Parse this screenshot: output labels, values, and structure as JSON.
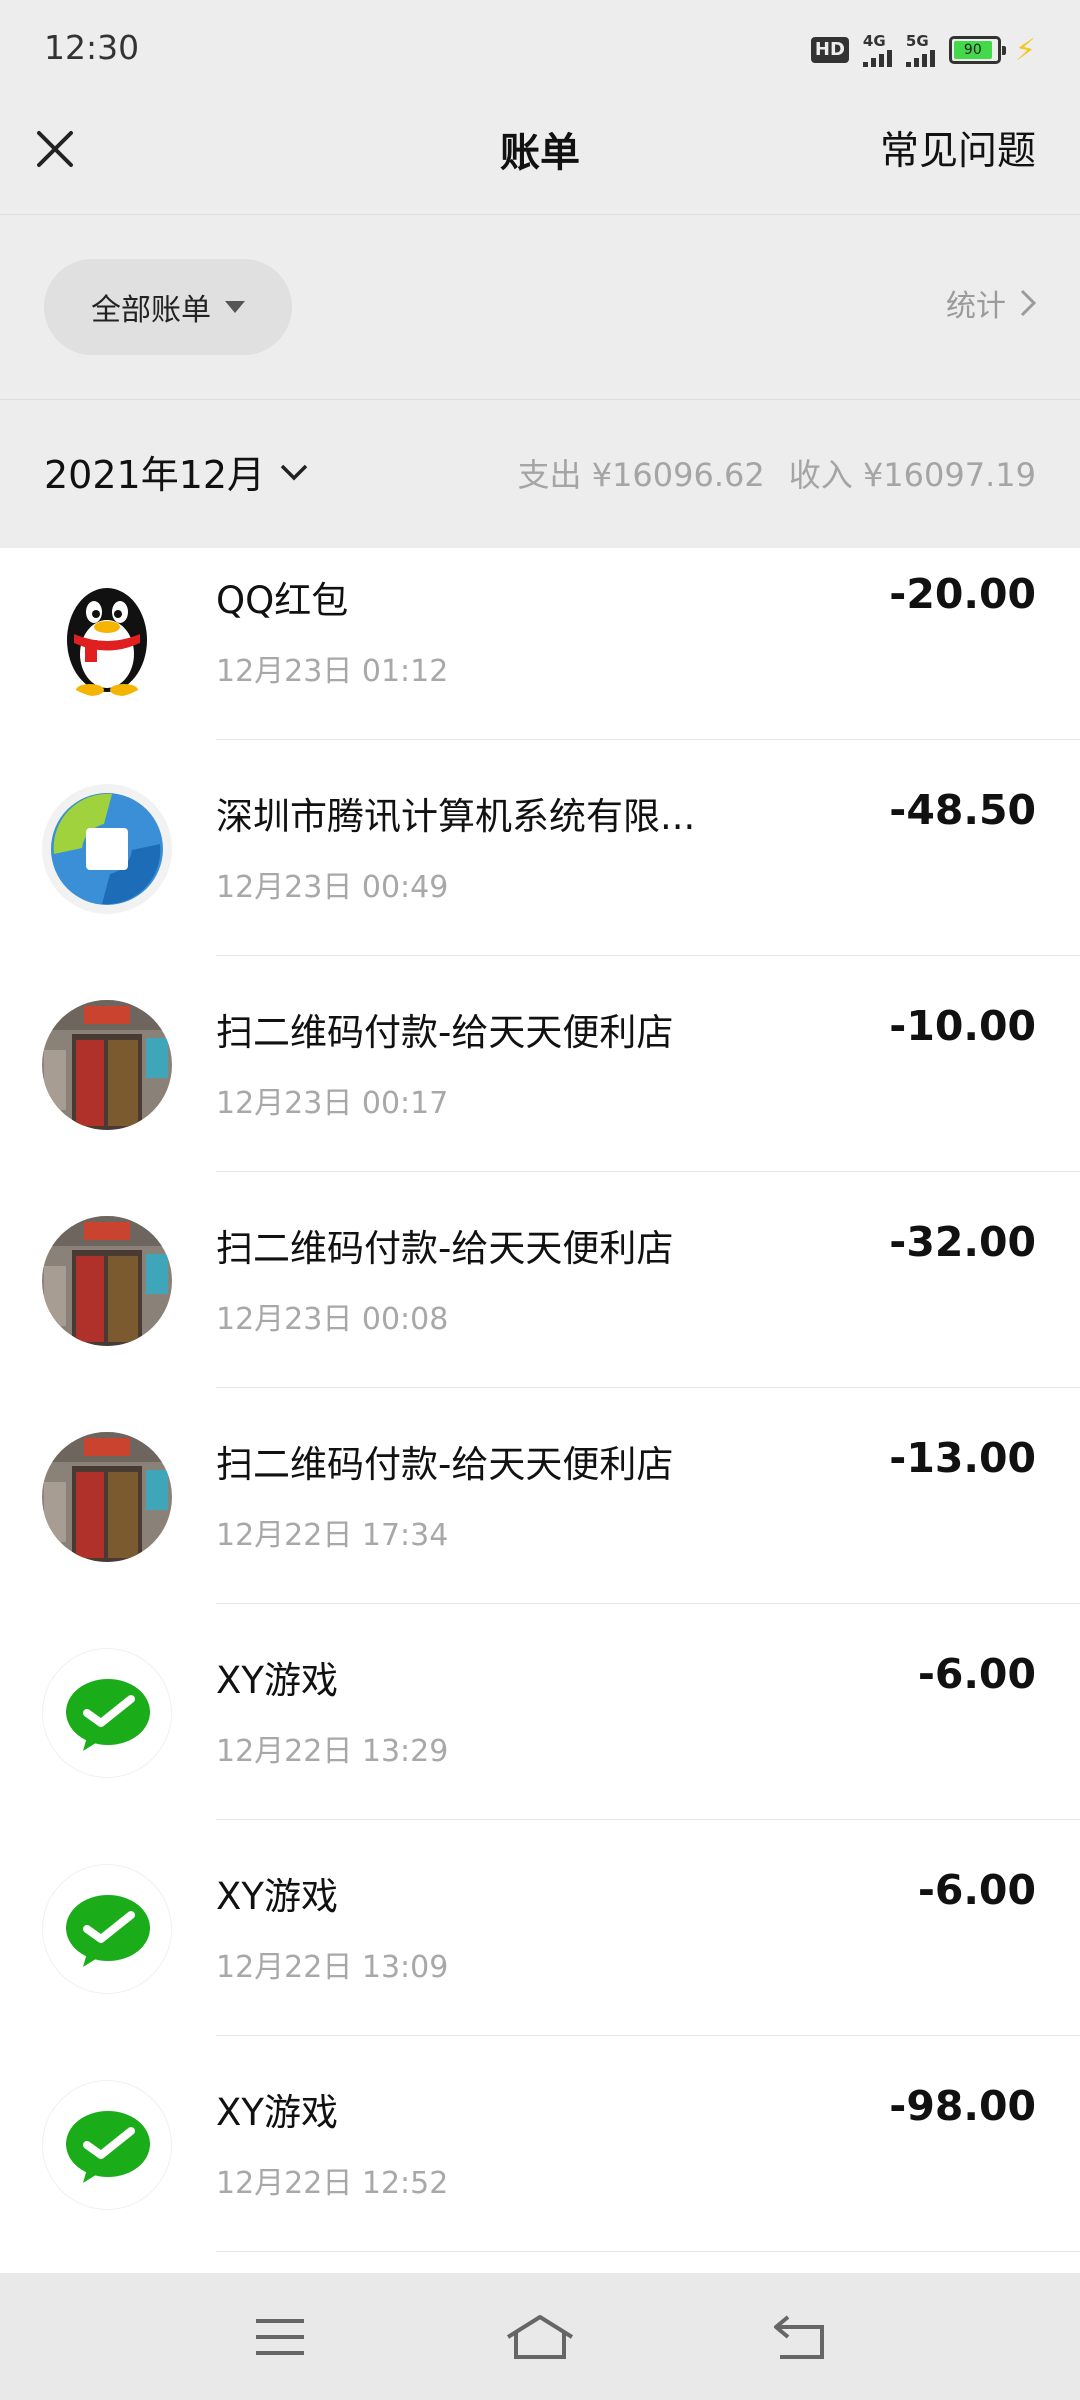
{
  "status": {
    "time": "12:30",
    "hd": "HD",
    "net1": "4G",
    "net2": "5G",
    "battery": "90"
  },
  "nav": {
    "title": "账单",
    "faq": "常见问题"
  },
  "filter": {
    "all_bills": "全部账单",
    "stats": "统计"
  },
  "month": {
    "label": "2021年12月",
    "expense": "支出 ¥16096.62",
    "income": "收入 ¥16097.19"
  },
  "transactions": [
    {
      "name": "QQ红包",
      "time": "12月23日 01:12",
      "amount": "-20.00",
      "icon": "qq-penguin-icon"
    },
    {
      "name": "深圳市腾讯计算机系统有限...",
      "time": "12月23日 00:49",
      "amount": "-48.50",
      "icon": "tencent-payment-icon"
    },
    {
      "name": "扫二维码付款-给天天便利店",
      "time": "12月23日 00:17",
      "amount": "-10.00",
      "icon": "store-photo-icon"
    },
    {
      "name": "扫二维码付款-给天天便利店",
      "time": "12月23日 00:08",
      "amount": "-32.00",
      "icon": "store-photo-icon"
    },
    {
      "name": "扫二维码付款-给天天便利店",
      "time": "12月22日 17:34",
      "amount": "-13.00",
      "icon": "store-photo-icon"
    },
    {
      "name": "XY游戏",
      "time": "12月22日 13:29",
      "amount": "-6.00",
      "icon": "wechat-pay-icon"
    },
    {
      "name": "XY游戏",
      "time": "12月22日 13:09",
      "amount": "-6.00",
      "icon": "wechat-pay-icon"
    },
    {
      "name": "XY游戏",
      "time": "12月22日 12:52",
      "amount": "-98.00",
      "icon": "wechat-pay-icon"
    }
  ],
  "colors": {
    "background": "#ededed",
    "list_background": "#ffffff",
    "muted_text": "#a8a8a8",
    "wechat_green": "#1aad19"
  }
}
